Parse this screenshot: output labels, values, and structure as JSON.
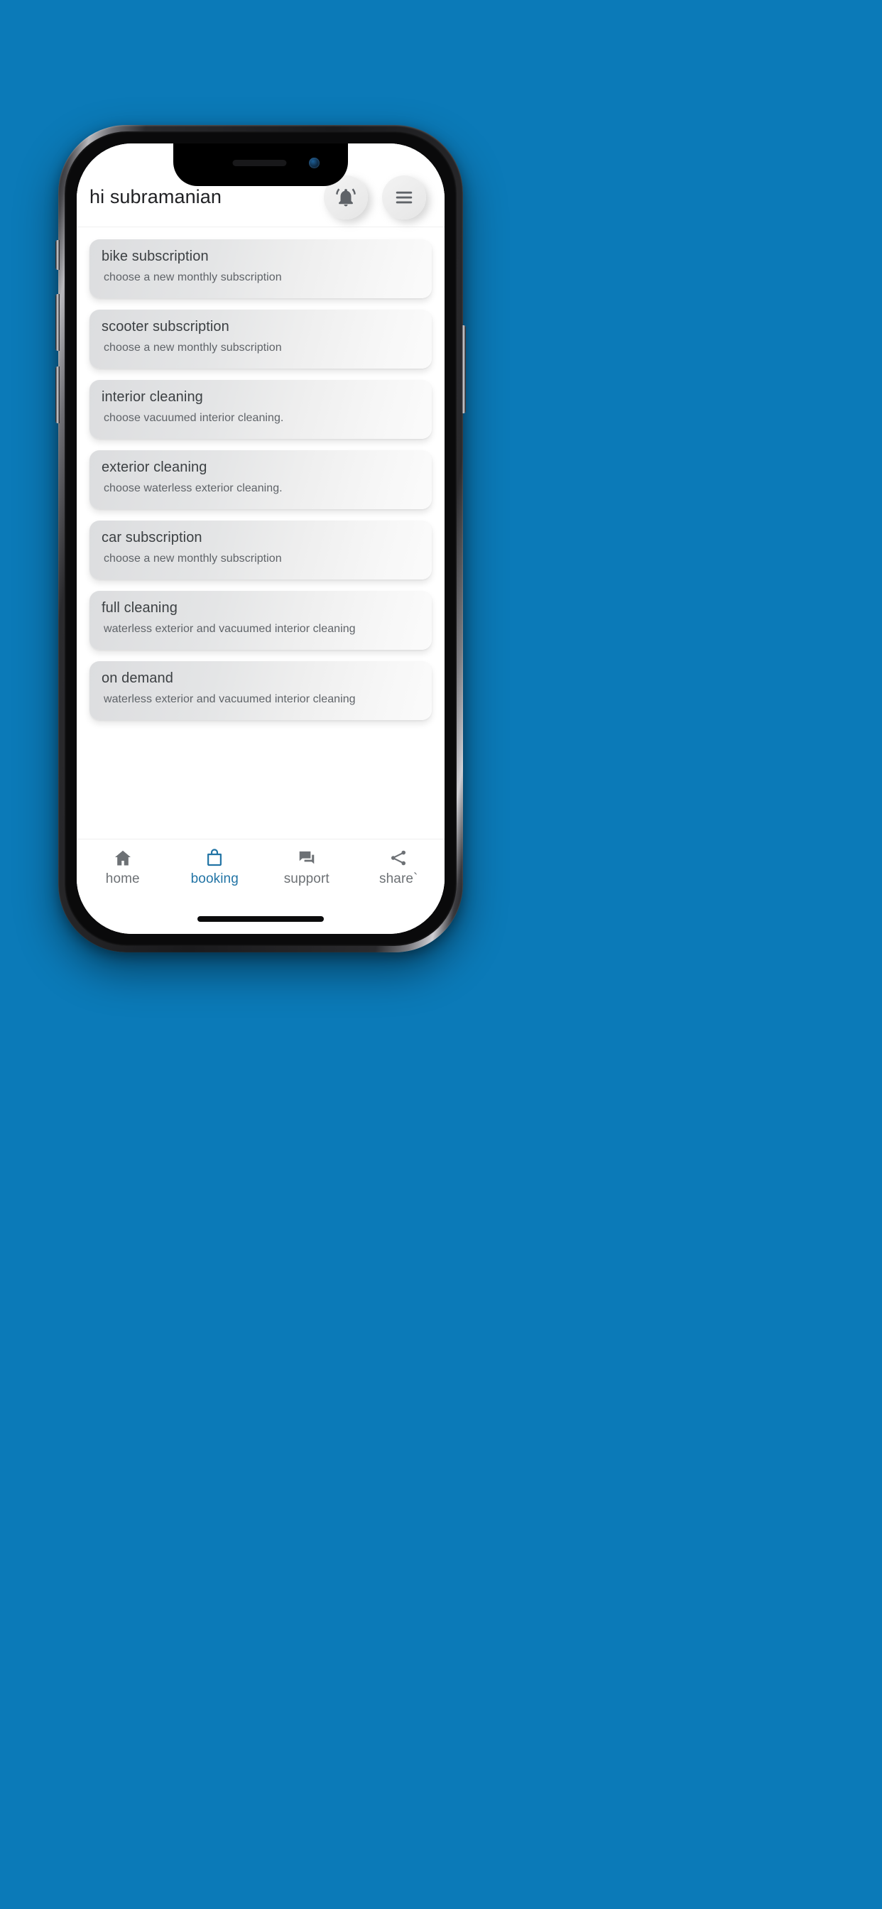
{
  "background": {
    "color": "#0b7ab8"
  },
  "device": {
    "name": "smartphone-mockup",
    "notch": {
      "speaker": "speaker-grille",
      "camera": "front-camera"
    },
    "side_buttons": [
      "silence-switch",
      "volume-up",
      "volume-down",
      "power"
    ],
    "home_indicator": "home-indicator"
  },
  "header": {
    "greeting": "hi subramanian",
    "notification_icon": "notifications-active-bell-icon",
    "menu_icon": "hamburger-menu-icon"
  },
  "cards": [
    {
      "title": "bike subscription",
      "subtitle": "choose a new monthly subscription"
    },
    {
      "title": "scooter subscription",
      "subtitle": "choose a new monthly subscription"
    },
    {
      "title": "interior cleaning",
      "subtitle": "choose vacuumed interior cleaning."
    },
    {
      "title": "exterior cleaning",
      "subtitle": "choose waterless exterior cleaning."
    },
    {
      "title": "car subscription",
      "subtitle": "choose a new monthly subscription"
    },
    {
      "title": "full cleaning",
      "subtitle": "waterless exterior and vacuumed interior cleaning"
    },
    {
      "title": "on demand",
      "subtitle": "waterless exterior and vacuumed interior cleaning"
    }
  ],
  "bottom_nav": {
    "active_color": "#2274a5",
    "inactive_color": "#6d7175",
    "items": [
      {
        "label": "home",
        "icon": "home-icon",
        "active": false
      },
      {
        "label": "booking",
        "icon": "shopping-bag-icon",
        "active": true
      },
      {
        "label": "support",
        "icon": "forum-chat-icon",
        "active": false
      },
      {
        "label": "share`",
        "icon": "share-nodes-icon",
        "active": false
      }
    ]
  }
}
